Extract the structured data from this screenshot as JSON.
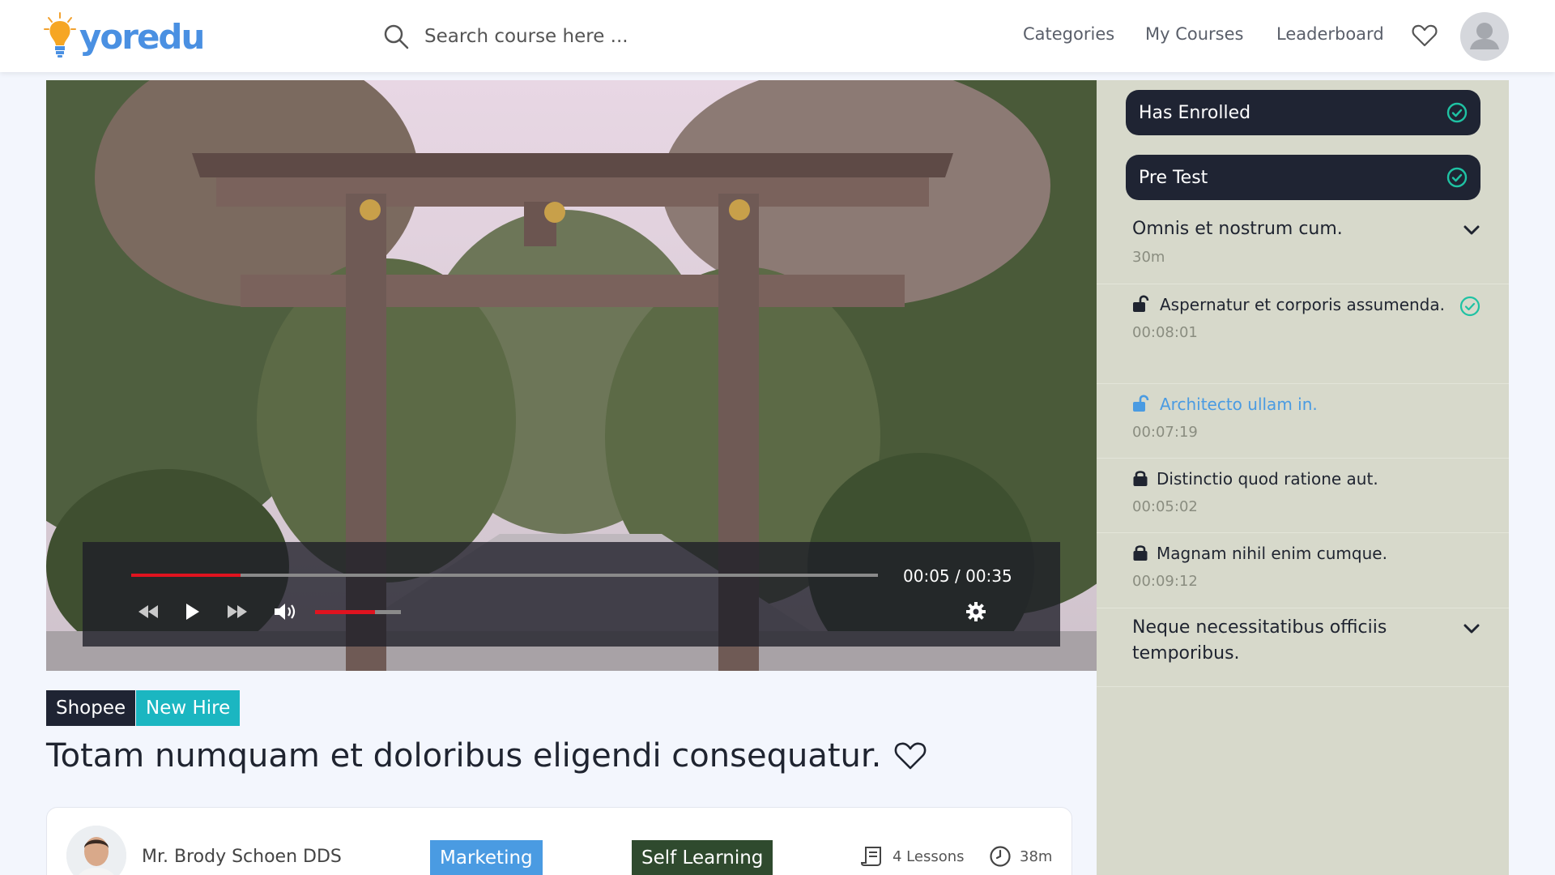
{
  "header": {
    "logo_text": "yoredu",
    "search_placeholder": "Search course here ...",
    "nav": {
      "categories": "Categories",
      "my_courses": "My Courses",
      "leaderboard": "Leaderboard"
    }
  },
  "video": {
    "time_display": "00:05 / 00:35",
    "progress": 0.146,
    "volume": 0.7
  },
  "course": {
    "tags": [
      "Shopee",
      "New Hire"
    ],
    "title": "Totam numquam et doloribus eligendi consequatur.",
    "instructor": "Mr. Brody Schoen DDS",
    "category": "Marketing",
    "learning_type": "Self Learning",
    "lessons_count": "4 Lessons",
    "duration": "38m"
  },
  "sidebar": {
    "has_enrolled": "Has Enrolled",
    "pre_test": "Pre Test",
    "sections": [
      {
        "title": "Omnis et nostrum cum.",
        "duration": "30m",
        "lessons": [
          {
            "title": "Aspernatur et corporis assumenda.",
            "time": "00:08:01",
            "status": "unlocked-complete"
          },
          {
            "title": "Architecto ullam in.",
            "time": "00:07:19",
            "status": "active"
          },
          {
            "title": "Distinctio quod ratione aut.",
            "time": "00:05:02",
            "status": "locked"
          },
          {
            "title": "Magnam nihil enim cumque.",
            "time": "00:09:12",
            "status": "locked"
          }
        ]
      },
      {
        "title": "Neque necessitatibus officiis temporibus."
      }
    ]
  },
  "colors": {
    "brand_blue": "#4a90e2",
    "dark_pill": "#1f2433",
    "teal": "#1bb6c1",
    "check_teal": "#1fc2a3",
    "active_lesson": "#4a9be2",
    "marketing_blue": "#4a9be2",
    "self_learning_green": "#2f4a2e",
    "tag_dark": "#1f2433",
    "sidebar_bg": "#d7d9cb",
    "progress_red": "#e0131f"
  }
}
